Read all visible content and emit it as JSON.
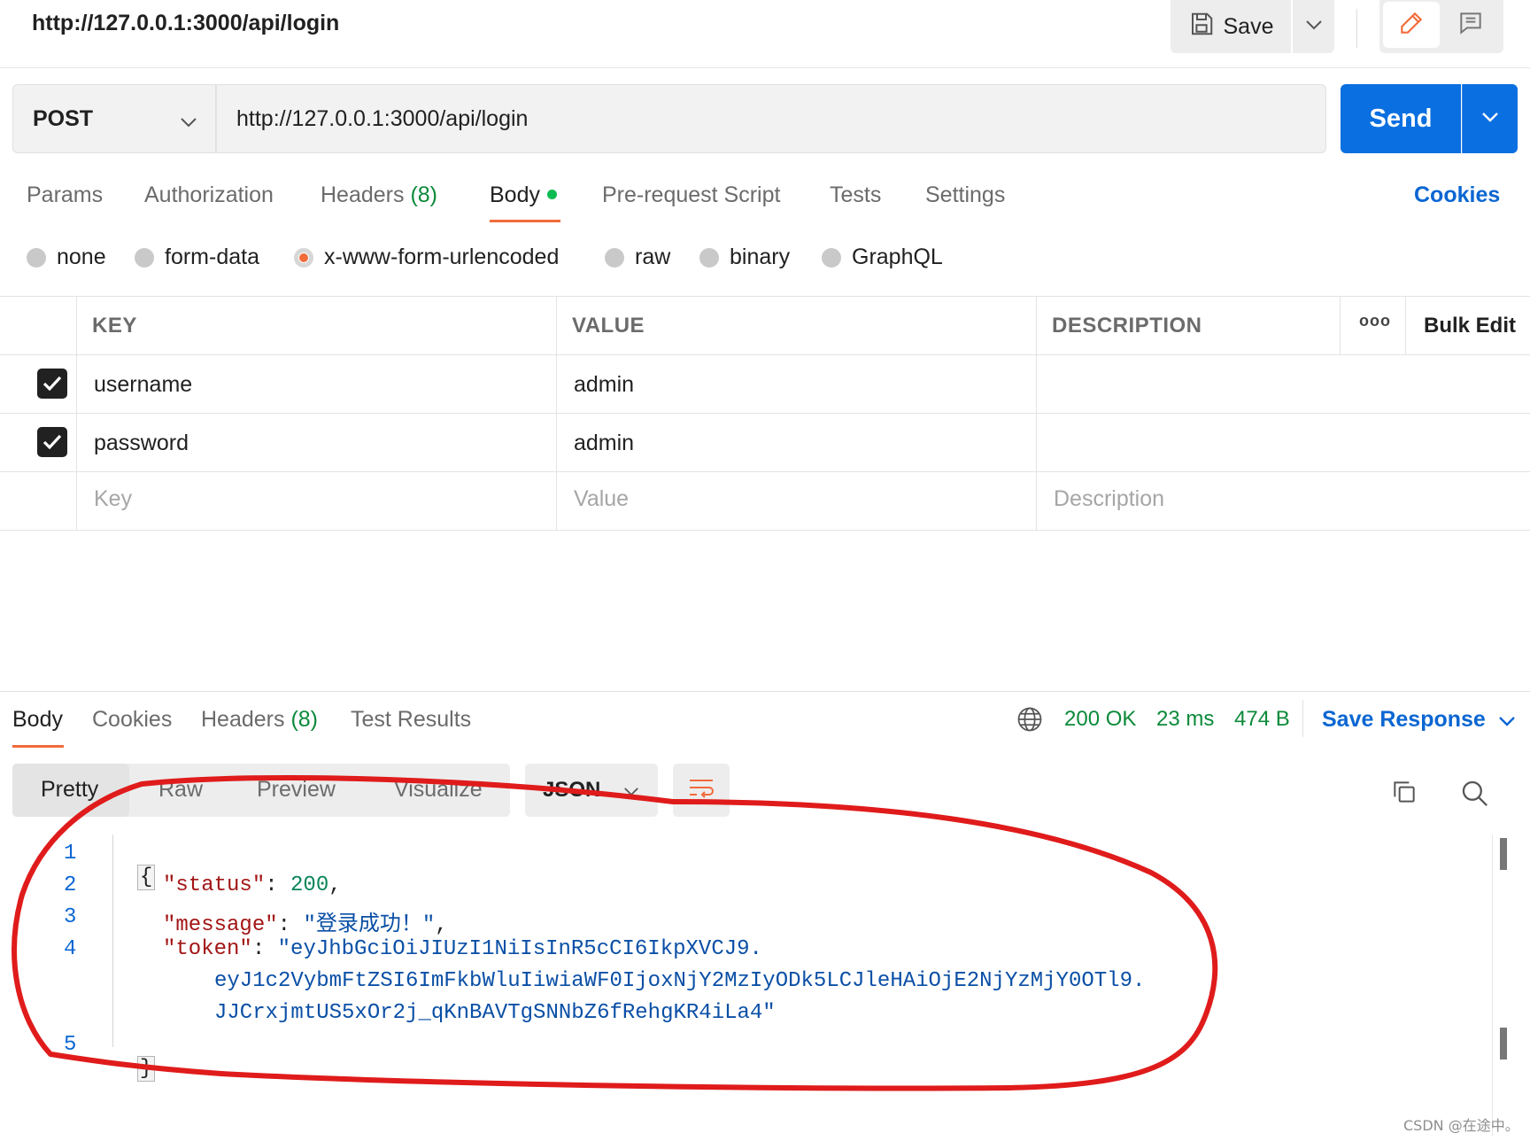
{
  "header": {
    "title": "http://127.0.0.1:3000/api/login",
    "save_label": "Save"
  },
  "request": {
    "method": "POST",
    "url": "http://127.0.0.1:3000/api/login",
    "send_label": "Send"
  },
  "request_tabs": {
    "params": "Params",
    "authorization": "Authorization",
    "headers": "Headers",
    "headers_count": "(8)",
    "body": "Body",
    "pre_request": "Pre-request Script",
    "tests": "Tests",
    "settings": "Settings",
    "cookies": "Cookies",
    "active": "Body"
  },
  "body_types": {
    "none": "none",
    "form_data": "form-data",
    "urlencoded": "x-www-form-urlencoded",
    "raw": "raw",
    "binary": "binary",
    "graphql": "GraphQL",
    "selected": "x-www-form-urlencoded"
  },
  "params_table": {
    "headers": {
      "key": "KEY",
      "value": "VALUE",
      "description": "DESCRIPTION",
      "more": "ooo",
      "bulk_edit": "Bulk Edit"
    },
    "rows": [
      {
        "checked": true,
        "key": "username",
        "value": "admin",
        "description": ""
      },
      {
        "checked": true,
        "key": "password",
        "value": "admin",
        "description": ""
      }
    ],
    "placeholders": {
      "key": "Key",
      "value": "Value",
      "description": "Description"
    }
  },
  "response": {
    "tabs": {
      "body": "Body",
      "cookies": "Cookies",
      "headers": "Headers",
      "headers_count": "(8)",
      "test_results": "Test Results",
      "active": "Body"
    },
    "status": "200 OK",
    "time": "23 ms",
    "size": "474 B",
    "save_response": "Save Response",
    "view_tabs": {
      "pretty": "Pretty",
      "raw": "Raw",
      "preview": "Preview",
      "visualize": "Visualize",
      "active": "Pretty"
    },
    "format": "JSON",
    "code": {
      "line_numbers": [
        "1",
        "2",
        "3",
        "4",
        "5"
      ],
      "open_brace": "{",
      "close_brace": "}",
      "status_key": "\"status\"",
      "status_value": "200",
      "message_key": "\"message\"",
      "message_value": "\"登录成功！\"",
      "token_key": "\"token\"",
      "token_line1": "\"eyJhbGciOiJIUzI1NiIsInR5cCI6IkpXVCJ9.",
      "token_line2": "eyJ1c2VybmFtZSI6ImFkbWluIiwiaWF0IjoxNjY2MzIyODk5LCJleHAiOjE2NjYzMjY0OTl9.",
      "token_line3": "JJCrxjmtUS5xOr2j_qKnBAVTgSNNbZ6fRehgKR4iLa4\""
    }
  },
  "watermark": "CSDN @在途中。",
  "colors": {
    "accent": "#f26b3a",
    "send": "#0a6fe0",
    "link": "#0b66d2",
    "success": "#0c8a3a",
    "annotation": "#e01b1b"
  }
}
